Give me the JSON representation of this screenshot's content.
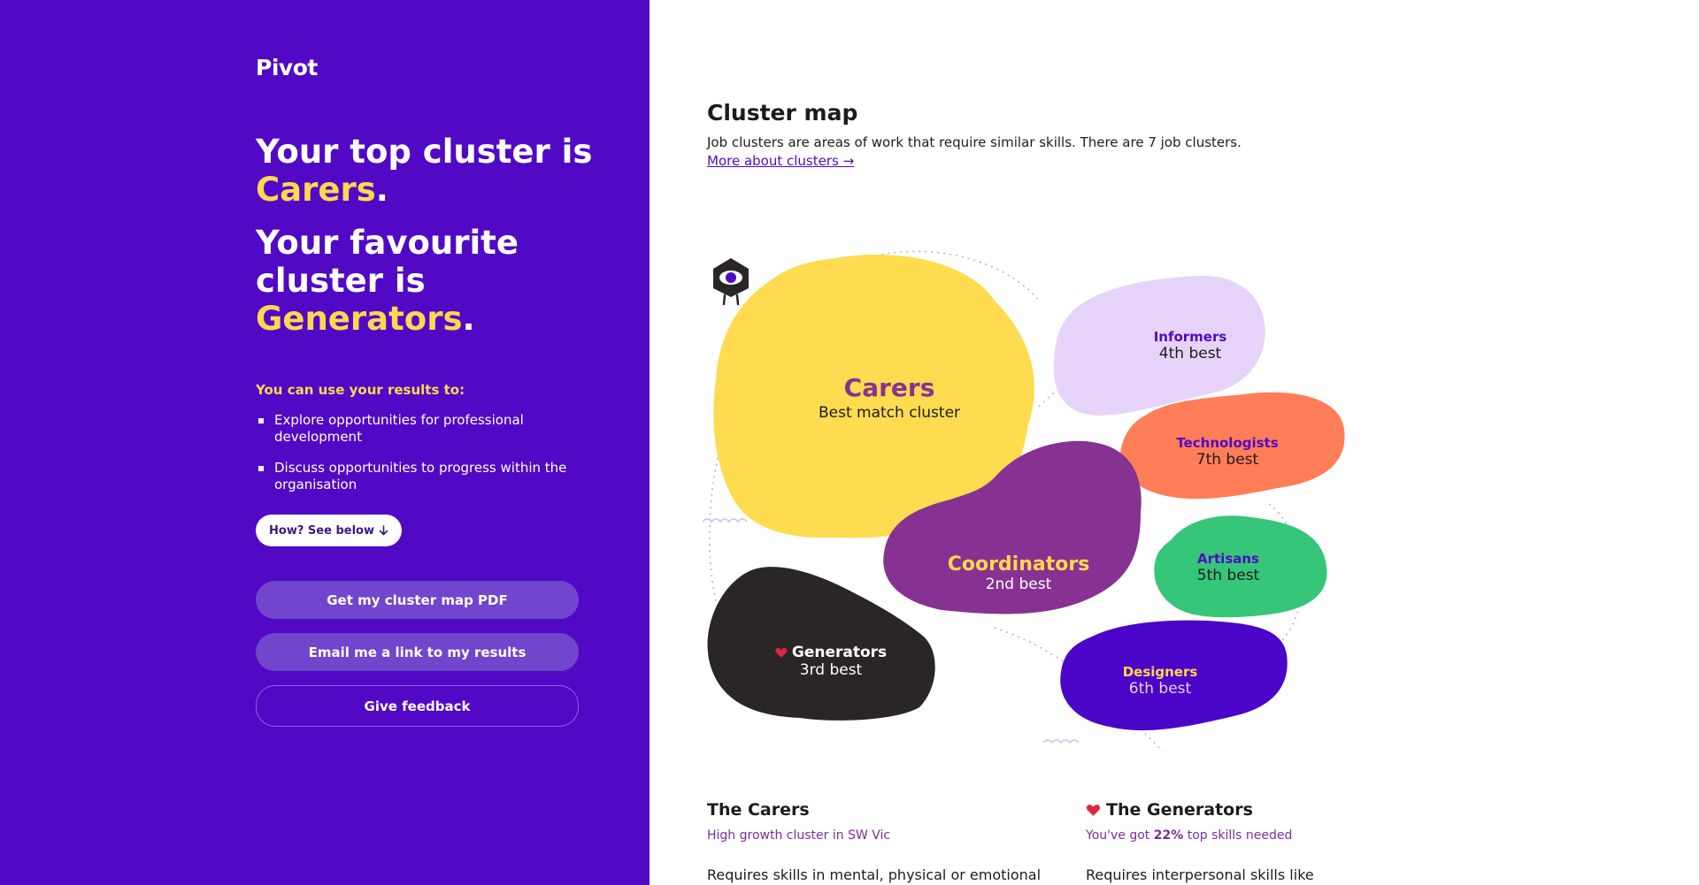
{
  "brand": {
    "logo_text": "Pivot"
  },
  "hero": {
    "line1_prefix": "Your top cluster is",
    "top_cluster": "Carers",
    "period": ".",
    "line2_prefix": "Your favourite cluster is",
    "favourite_cluster": "Generators"
  },
  "uses": {
    "title": "You can use your results to:",
    "items": [
      "Explore opportunities for professional development",
      "Discuss opportunities to progress within the organisation"
    ]
  },
  "buttons": {
    "how": "How? See below",
    "pdf": "Get my cluster map PDF",
    "email": "Email me a link to my results",
    "feedback": "Give feedback"
  },
  "map": {
    "title": "Cluster map",
    "description": "Job clusters are areas of work that require similar skills. There are 7 job clusters.",
    "link": "More about clusters →",
    "clusters": {
      "carers": {
        "name": "Carers",
        "rank": "Best match cluster",
        "color": "#fedb4f"
      },
      "informers": {
        "name": "Informers",
        "rank": "4th best",
        "color": "#e6d3f9"
      },
      "technologists": {
        "name": "Technologists",
        "rank": "7th best",
        "color": "#ff7d57"
      },
      "coordinators": {
        "name": "Coordinators",
        "rank": "2nd best",
        "color": "#873292"
      },
      "artisans": {
        "name": "Artisans",
        "rank": "5th best",
        "color": "#35c679"
      },
      "generators": {
        "name": "Generators",
        "rank": "3rd best",
        "color": "#2b2626"
      },
      "designers": {
        "name": "Designers",
        "rank": "6th best",
        "color": "#4a05c8"
      }
    }
  },
  "cards": {
    "carers": {
      "title": "The Carers",
      "subtitle": "High growth cluster in SW Vic",
      "body": "Requires skills in mental, physical or emotional"
    },
    "generators": {
      "title": "The Generators",
      "subtitle_prefix": "You've got",
      "subtitle_value": "22%",
      "subtitle_suffix": "top skills needed",
      "body": "Requires interpersonal skills like"
    }
  },
  "colors": {
    "panel": "#5109c6",
    "accent_yellow": "#ffd84d",
    "heart": "#d8283e",
    "link": "#5109c6"
  }
}
